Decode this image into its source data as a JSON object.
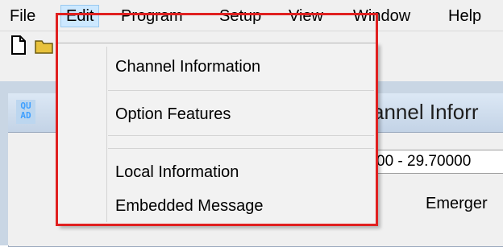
{
  "menubar": {
    "items": [
      "File",
      "Edit",
      "Program",
      "Setup",
      "View",
      "Window",
      "Help"
    ]
  },
  "toolbar": {
    "icons": [
      "new-document-icon",
      "open-folder-icon"
    ]
  },
  "child_window": {
    "icon_text_line1": "QU",
    "icon_text_line2": "AD",
    "title_partial": "annel Inforr",
    "range_value": "00 - 29.70000",
    "emergency_label": "Emerger"
  },
  "edit_menu": {
    "items": [
      "Channel Information",
      "Option Features",
      "Local Information",
      "Embedded Message"
    ]
  },
  "colors": {
    "menu_highlight": "#cce8ff",
    "annotation_border": "#e02020",
    "mdi_background": "#c9d6e4"
  }
}
